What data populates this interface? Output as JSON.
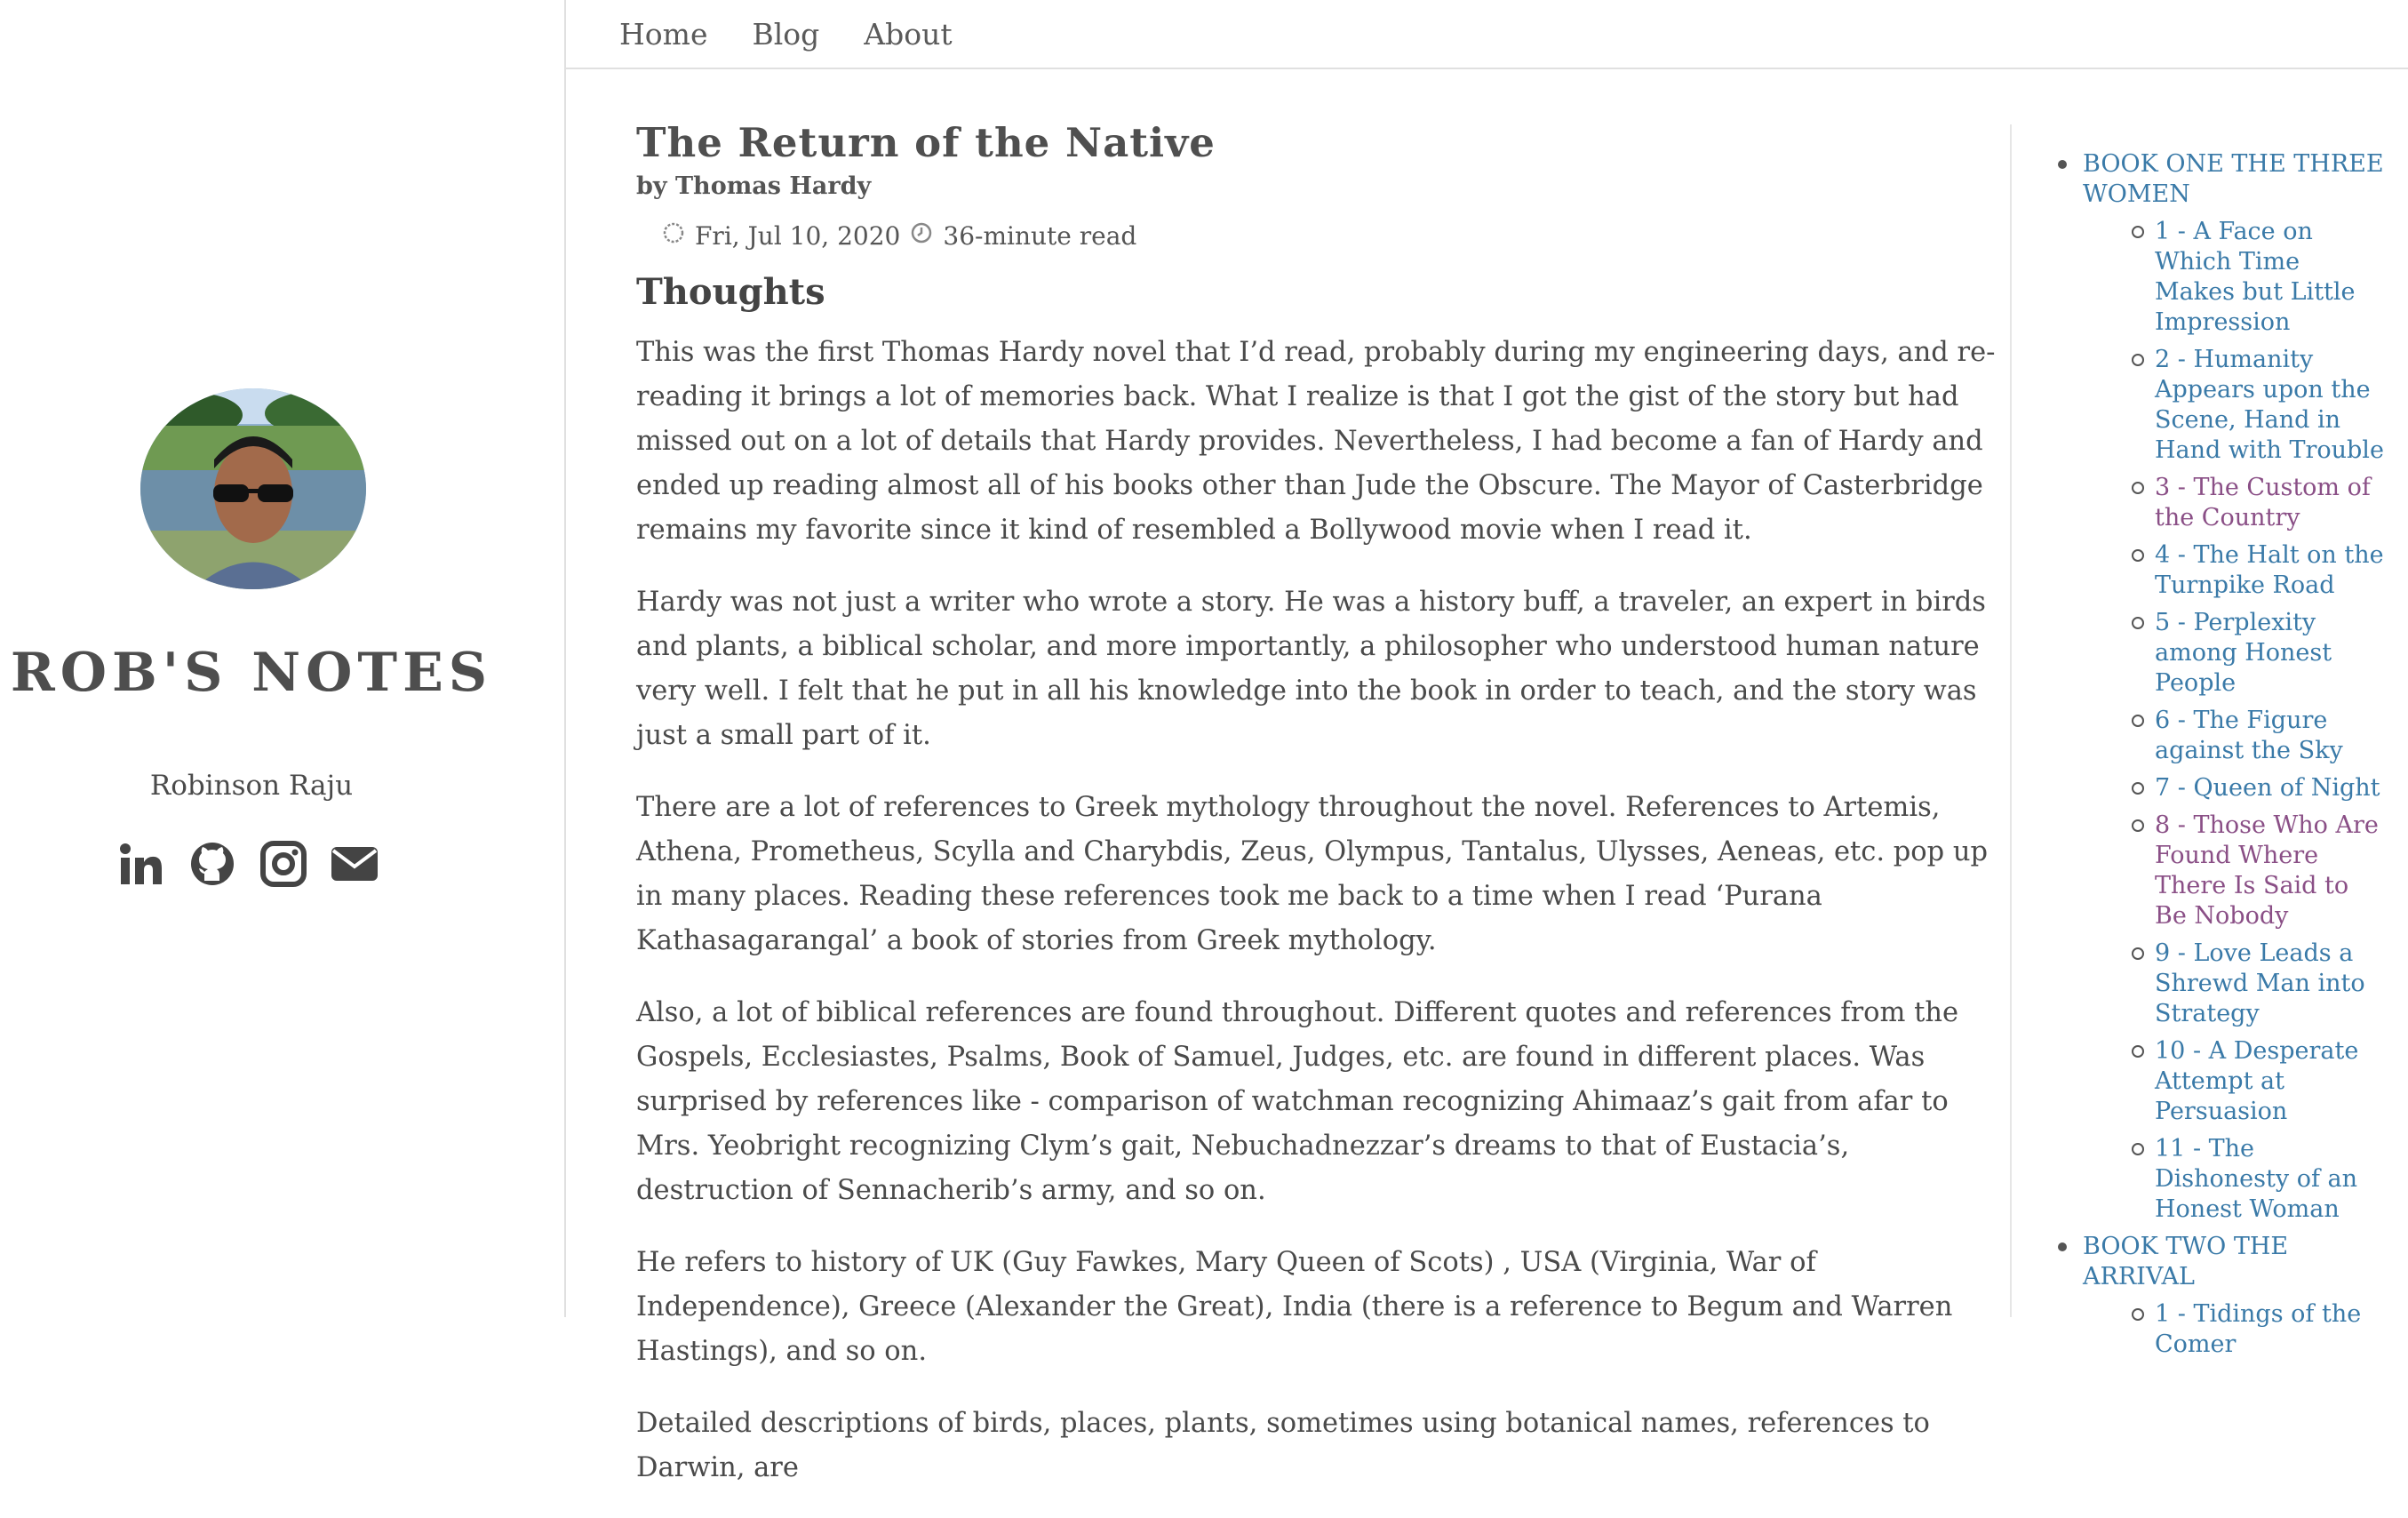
{
  "site": {
    "title": "ROB'S NOTES",
    "author": "Robinson Raju",
    "social": [
      "linkedin-icon",
      "github-icon",
      "instagram-icon",
      "envelope-icon"
    ]
  },
  "nav": {
    "items": [
      "Home",
      "Blog",
      "About"
    ]
  },
  "post": {
    "title": "The Return of the Native",
    "byline": "by Thomas Hardy",
    "date": "Fri, Jul 10, 2020",
    "read_time": "36-minute read",
    "section_heading": "Thoughts",
    "paragraphs": [
      "This was the first Thomas Hardy novel that I’d read, probably during my engineering days, and re-reading it brings a lot of memories back. What I realize is that I got the gist of the story but had missed out on a lot of details that Hardy provides. Nevertheless, I had become a fan of Hardy and ended up reading almost all of his books other than Jude the Obscure. The Mayor of Casterbridge remains my favorite since it kind of resembled a Bollywood movie when I read it.",
      "Hardy was not just a writer who wrote a story. He was a history buff, a traveler, an expert in birds and plants, a biblical scholar, and more importantly, a philosopher who understood human nature very well. I felt that he put in all his knowledge into the book in order to teach, and the story was just a small part of it.",
      "There are a lot of references to Greek mythology throughout the novel. References to Artemis, Athena, Prometheus, Scylla and Charybdis, Zeus, Olympus, Tantalus, Ulysses, Aeneas, etc. pop up in many places. Reading these references took me back to a time when I read ‘Purana Kathasagarangal’ a book of stories from Greek mythology.",
      "Also, a lot of biblical references are found throughout. Different quotes and references from the Gospels, Ecclesiastes, Psalms, Book of Samuel, Judges, etc. are found in different places. Was surprised by references like - comparison of watchman recognizing Ahimaaz’s gait from afar to Mrs. Yeobright recognizing Clym’s gait, Nebuchadnezzar’s dreams to that of Eustacia’s, destruction of Sennacherib’s army, and so on.",
      "He refers to history of UK (Guy Fawkes, Mary Queen of Scots) , USA (Virginia, War of Independence), Greece (Alexander the Great), India (there is a reference to Begum and Warren Hastings), and so on.",
      "Detailed descriptions of birds, places, plants, sometimes using botanical names, references to Darwin, are"
    ]
  },
  "toc": {
    "book_one": "BOOK ONE THE THREE WOMEN",
    "chapters": [
      {
        "label": "1 - A Face on Which Time Makes but Little Impression",
        "visited": false
      },
      {
        "label": "2 - Humanity Appears upon the Scene, Hand in Hand with Trouble",
        "visited": false
      },
      {
        "label": "3 - The Custom of the Country",
        "visited": true
      },
      {
        "label": "4 - The Halt on the Turnpike Road",
        "visited": false
      },
      {
        "label": "5 - Perplexity among Honest People",
        "visited": false
      },
      {
        "label": "6 - The Figure against the Sky",
        "visited": false
      },
      {
        "label": "7 - Queen of Night",
        "visited": false
      },
      {
        "label": "8 - Those Who Are Found Where There Is Said to Be Nobody",
        "visited": true
      },
      {
        "label": "9 - Love Leads a Shrewd Man into Strategy",
        "visited": false
      },
      {
        "label": "10 - A Desperate Attempt at Persuasion",
        "visited": false
      },
      {
        "label": "11 - The Dishonesty of an Honest Woman",
        "visited": false
      }
    ],
    "book_two": "BOOK TWO THE ARRIVAL",
    "book_two_first": "1 - Tidings of the Comer"
  },
  "colors": {
    "link": "#3a7aa8",
    "visited": "#8a4f86",
    "text": "#4a4a4a"
  }
}
